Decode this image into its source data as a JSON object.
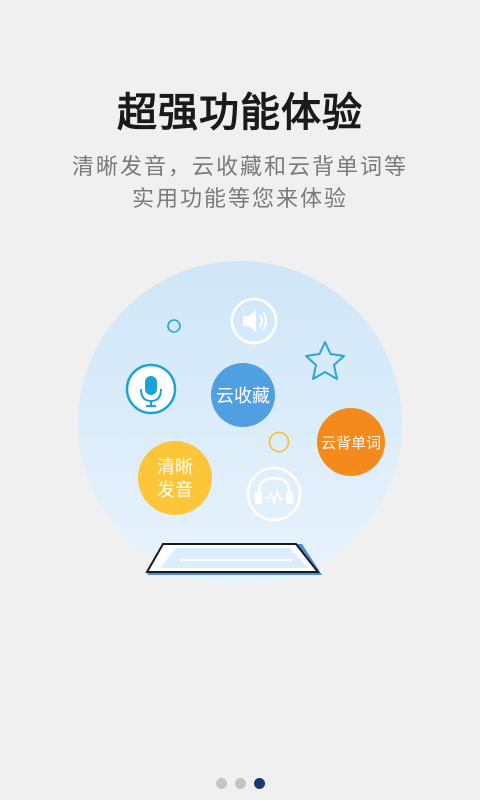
{
  "title": "超强功能体验",
  "subtitle": {
    "line1": "清晰发音，云收藏和云背单词等",
    "line2": "实用功能等您来体验"
  },
  "features": {
    "cloud_collect": "云收藏",
    "cloud_recite": "云背单词",
    "clear_pron_line1": "清晰",
    "clear_pron_line2": "发音"
  },
  "icons": [
    "speaker-icon",
    "microphone-icon",
    "star-icon",
    "headphones-icon",
    "phone-icon"
  ],
  "pager": {
    "count": 3,
    "active_index": 2
  },
  "colors": {
    "background": "#f0f0f0",
    "bubble_bg": "#d8ecfb",
    "cloud_collect": "#4f9fe1",
    "cloud_recite": "#f58a1c",
    "clear_pron": "#fcc638",
    "mic_accent": "#1aa3d6",
    "dot_active": "#163a6e",
    "dot_inactive": "#c4c4c4"
  }
}
